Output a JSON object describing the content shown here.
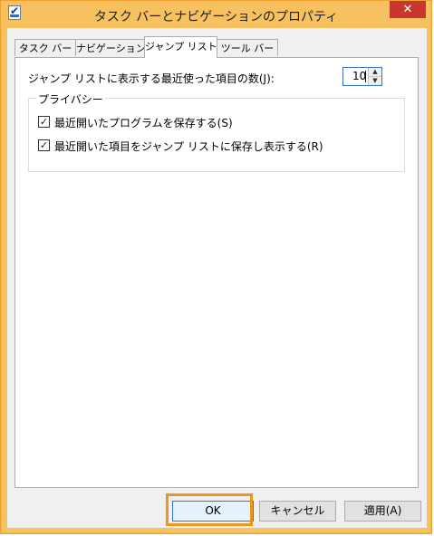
{
  "window": {
    "title": "タスク バーとナビゲーションのプロパティ",
    "close_label": "✕"
  },
  "tabs": [
    {
      "label": "タスク バー",
      "active": false
    },
    {
      "label": "ナビゲーション",
      "active": false
    },
    {
      "label": "ジャンプ リスト",
      "active": true
    },
    {
      "label": "ツール バー",
      "active": false
    }
  ],
  "jumplist": {
    "count_label": "ジャンプ リストに表示する最近使った項目の数(J):",
    "count_value": "10"
  },
  "privacy": {
    "caption": "プライバシー",
    "options": [
      {
        "label": "最近開いたプログラムを保存する(S)",
        "checked": true
      },
      {
        "label": "最近開いた項目をジャンプ リストに保存し表示する(R)",
        "checked": true
      }
    ]
  },
  "buttons": {
    "ok": "OK",
    "cancel": "キャンセル",
    "apply": "適用(A)"
  },
  "colors": {
    "frame": "#f6c15e",
    "close": "#c7372f",
    "highlight": "#f0941e",
    "focus": "#3a73c8"
  }
}
